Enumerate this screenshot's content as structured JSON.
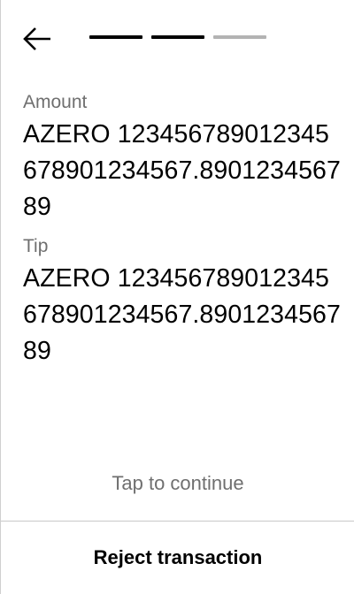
{
  "header": {
    "back_icon": "arrow-left-icon",
    "progress_steps": [
      {
        "state": "complete",
        "color": "#000000"
      },
      {
        "state": "current",
        "color": "#000000"
      },
      {
        "state": "pending",
        "color": "#b3b3b3"
      }
    ]
  },
  "fields": {
    "amount_label": "Amount",
    "amount_value": "AZERO 123456789012345678901234567.890123456789",
    "tip_label": "Tip",
    "tip_value": "AZERO 123456789012345678901234567.890123456789"
  },
  "footer": {
    "tap_hint": "Tap to continue",
    "reject_label": "Reject transaction"
  },
  "colors": {
    "text_primary": "#000000",
    "text_secondary": "#6f6f6f",
    "divider": "#c8c8c8",
    "progress_done": "#000000",
    "progress_pending": "#b3b3b3"
  }
}
